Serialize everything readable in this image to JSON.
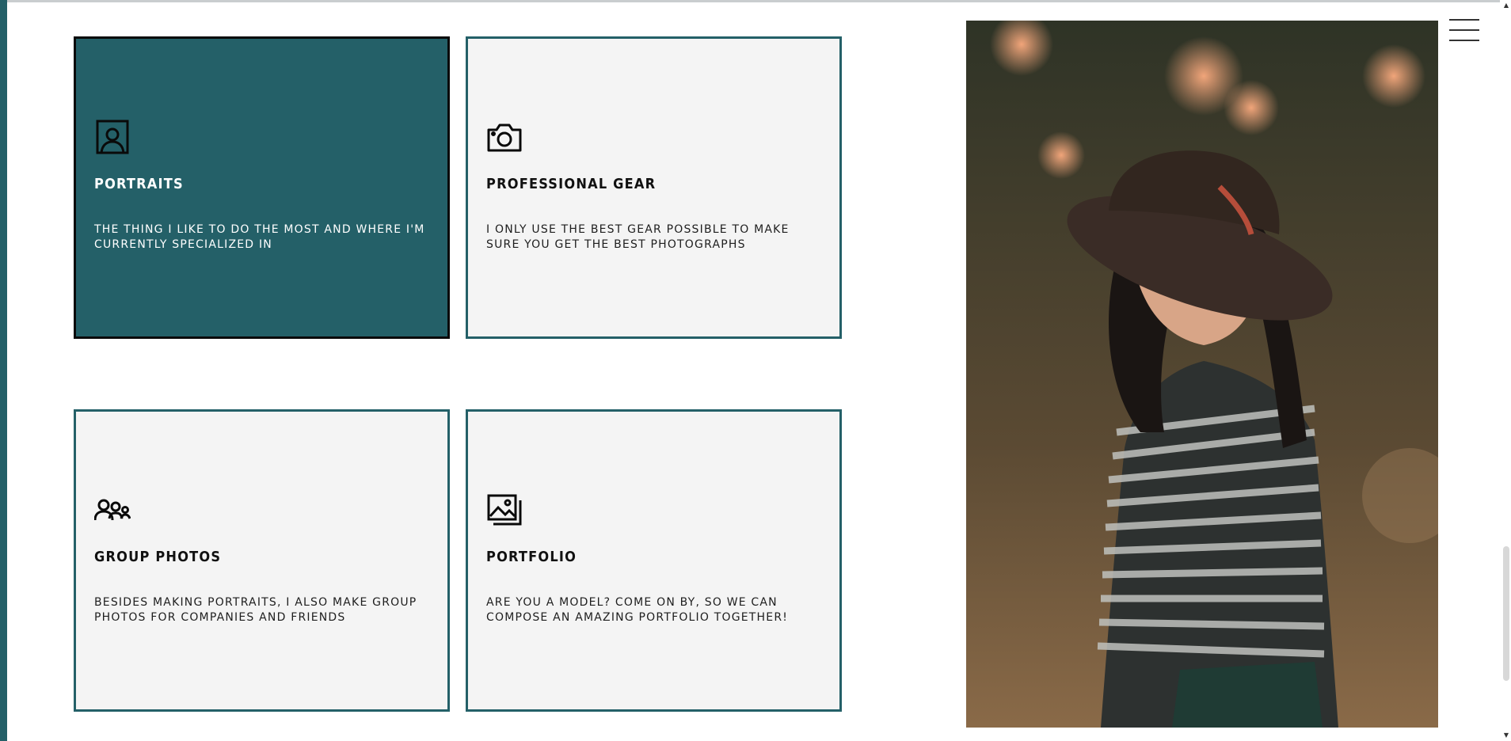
{
  "services": [
    {
      "title": "Portraits",
      "description": "The thing I like to do the most and where I'm currently specialized in",
      "icon": "portrait-icon"
    },
    {
      "title": "Professional Gear",
      "description": "I only use the best gear possible to make sure you get the best photographs",
      "icon": "camera-icon"
    },
    {
      "title": "Group Photos",
      "description": "Besides making portraits, I also make group photos for companies and friends",
      "icon": "group-icon"
    },
    {
      "title": "Portfolio",
      "description": "Are you a model? Come on by, so we can compose an amazing portfolio together!",
      "icon": "gallery-icon"
    }
  ],
  "colors": {
    "accent": "#246068",
    "card_bg": "#f4f4f4",
    "active_border": "#0a0a0a",
    "text": "#111111"
  },
  "menu": {
    "icon": "hamburger-menu-icon"
  },
  "photo": {
    "icon": "photo-woman-in-hat"
  }
}
